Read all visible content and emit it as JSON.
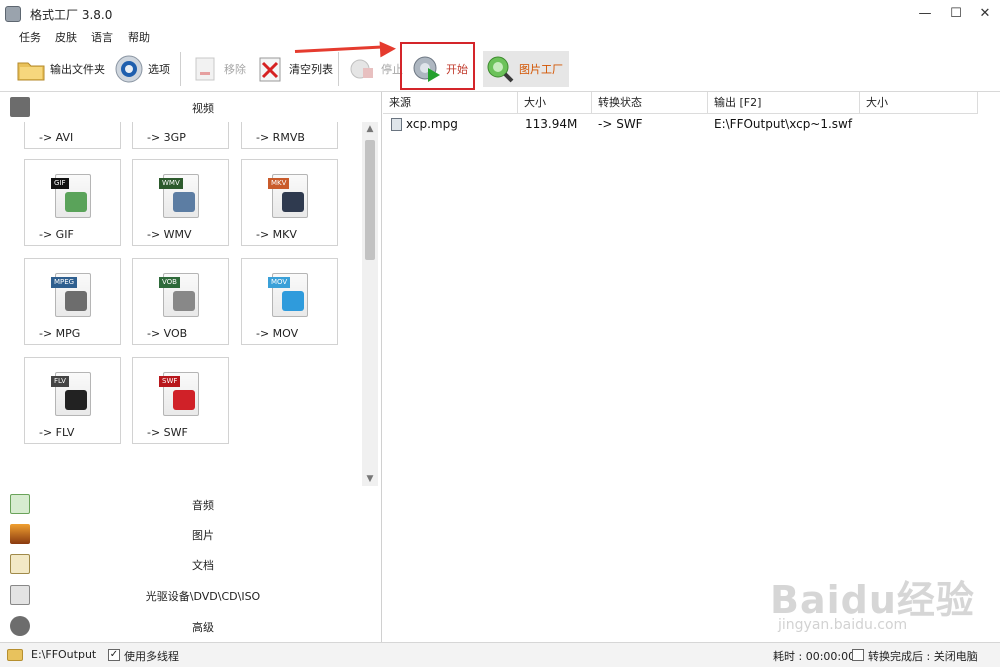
{
  "window": {
    "title": "格式工厂 3.8.0",
    "controls": [
      "—",
      "☐",
      "✕"
    ]
  },
  "menu": [
    "任务",
    "皮肤",
    "语言",
    "帮助"
  ],
  "toolbar": {
    "output_folder": "输出文件夹",
    "options": "选项",
    "remove": "移除",
    "clear_list": "清空列表",
    "stop": "停止",
    "start": "开始",
    "picture_factory": "图片工厂"
  },
  "left_panel": {
    "video_category": "视频",
    "tiles_row0": [
      "-> AVI",
      "-> 3GP",
      "-> RMVB"
    ],
    "tiles": [
      {
        "label": "-> GIF",
        "tag": "GIF",
        "tag_color": "#111111",
        "art_color": "#5aa35a"
      },
      {
        "label": "-> WMV",
        "tag": "WMV",
        "tag_color": "#2c5a2c",
        "art_color": "#5c7da3"
      },
      {
        "label": "-> MKV",
        "tag": "MKV",
        "tag_color": "#c95b2b",
        "art_color": "#2f3a4f"
      },
      {
        "label": "-> MPG",
        "tag": "MPEG",
        "tag_color": "#2f5f8f",
        "art_color": "#6d6d6d"
      },
      {
        "label": "-> VOB",
        "tag": "VOB",
        "tag_color": "#2e6a3a",
        "art_color": "#888888"
      },
      {
        "label": "-> MOV",
        "tag": "MOV",
        "tag_color": "#3aa0d8",
        "art_color": "#2f9bdc"
      },
      {
        "label": "-> FLV",
        "tag": "FLV",
        "tag_color": "#444444",
        "art_color": "#222222"
      },
      {
        "label": "-> SWF",
        "tag": "SWF",
        "tag_color": "#b8171c",
        "art_color": "#d02128"
      }
    ],
    "categories": [
      "音频",
      "图片",
      "文档",
      "光驱设备\\DVD\\CD\\ISO",
      "高级"
    ]
  },
  "table": {
    "columns": [
      "来源",
      "大小",
      "转换状态",
      "输出 [F2]",
      "大小"
    ],
    "rows": [
      {
        "source": "xcp.mpg",
        "size": "113.94M",
        "status": "-> SWF",
        "output": "E:\\FFOutput\\xcp~1.swf",
        "out_size": ""
      }
    ]
  },
  "status": {
    "output_path": "E:\\FFOutput",
    "multithread": "使用多线程",
    "elapsed": "耗时 : 00:00:00",
    "after_done": "转换完成后 : 关闭电脑"
  },
  "watermark": {
    "brand": "Baidu经验",
    "url": "jingyan.baidu.com"
  }
}
